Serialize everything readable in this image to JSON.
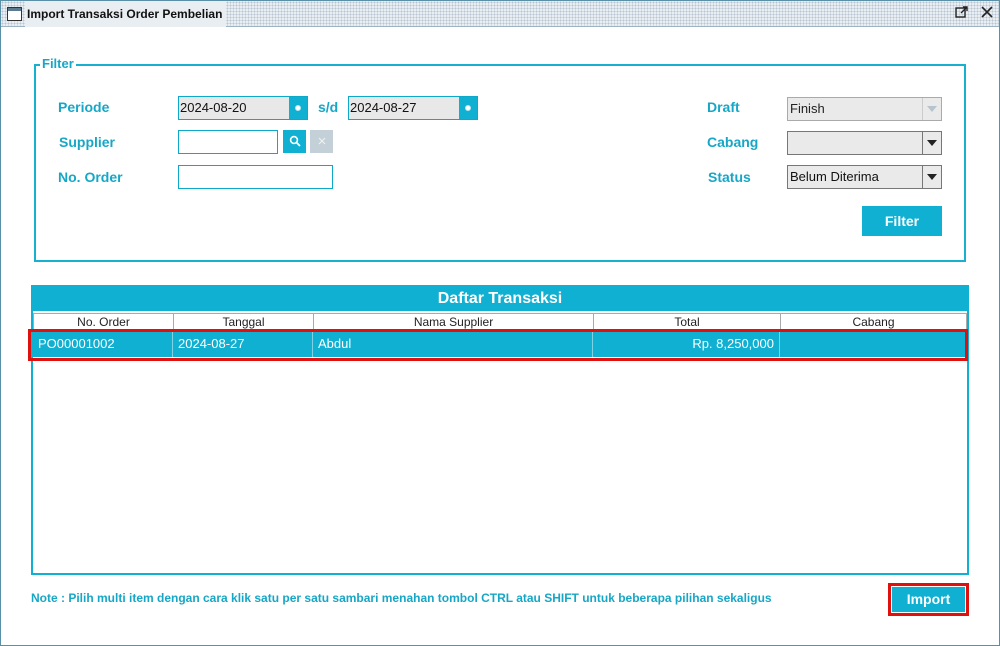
{
  "window": {
    "title": "Import Transaksi Order Pembelian"
  },
  "filter": {
    "legend": "Filter",
    "periode_label": "Periode",
    "date_from": "2024-08-20",
    "sd_label": "s/d",
    "date_to": "2024-08-27",
    "supplier_label": "Supplier",
    "supplier_value": "",
    "no_order_label": "No. Order",
    "no_order_value": "",
    "draft_label": "Draft",
    "draft_value": "Finish",
    "cabang_label": "Cabang",
    "cabang_value": "",
    "status_label": "Status",
    "status_value": "Belum Diterima",
    "filter_button": "Filter"
  },
  "table": {
    "title": "Daftar Transaksi",
    "columns": [
      "No. Order",
      "Tanggal",
      "Nama Supplier",
      "Total",
      "Cabang"
    ],
    "rows": [
      {
        "no_order": "PO00001002",
        "tanggal": "2024-08-27",
        "nama_supplier": "Abdul",
        "total": "Rp. 8,250,000",
        "cabang": ""
      }
    ]
  },
  "note": "Note : Pilih multi item dengan cara klik satu per satu sambari menahan tombol CTRL atau SHIFT untuk beberapa pilihan sekaligus",
  "import_button": "Import",
  "icons": {
    "window": "window-icon",
    "maximize": "maximize-icon",
    "close": "close-icon",
    "search": "search-icon",
    "clear": "clear-icon",
    "calendar": "calendar-icon",
    "dropdown": "chevron-down-icon"
  },
  "colors": {
    "accent": "#0fb0d1",
    "highlight": "#e0100f"
  }
}
